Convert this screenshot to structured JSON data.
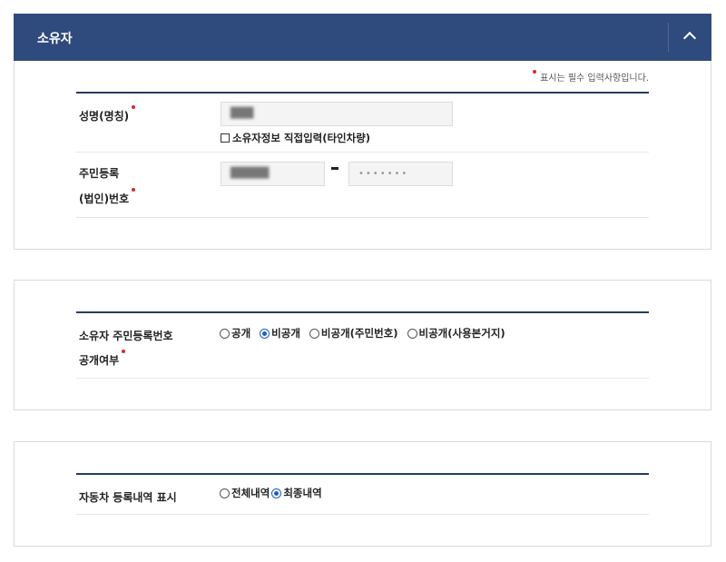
{
  "owner_panel": {
    "title": "소유자",
    "required_note": "표시는 필수 입력사항입니다.",
    "name_label": "성명(명칭)",
    "name_value": "███",
    "direct_input_label": "소유자정보 직접입력(타인차량)",
    "reg_label_line1": "주민등록",
    "reg_label_line2": "(법인)번호",
    "reg_front_value": "█████",
    "reg_back_value": "•••••••"
  },
  "disclosure_panel": {
    "label_line1": "소유자 주민등록번호",
    "label_line2": "공개여부",
    "options": [
      "공개",
      "비공개",
      "비공개(주민번호)",
      "비공개(사용본거지)"
    ],
    "selected": "비공개"
  },
  "history_panel": {
    "label": "자동차 등록내역 표시",
    "options": [
      "전체내역",
      "최종내역"
    ],
    "selected": "최종내역"
  }
}
